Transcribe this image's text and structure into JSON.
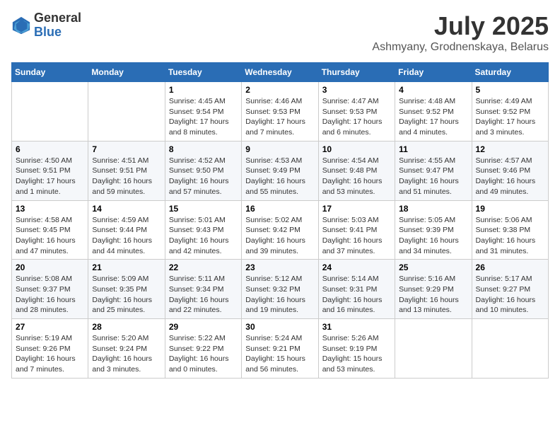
{
  "header": {
    "logo_general": "General",
    "logo_blue": "Blue",
    "month_title": "July 2025",
    "location": "Ashmyany, Grodnenskaya, Belarus"
  },
  "weekdays": [
    "Sunday",
    "Monday",
    "Tuesday",
    "Wednesday",
    "Thursday",
    "Friday",
    "Saturday"
  ],
  "weeks": [
    [
      {
        "day": "",
        "info": ""
      },
      {
        "day": "",
        "info": ""
      },
      {
        "day": "1",
        "info": "Sunrise: 4:45 AM\nSunset: 9:54 PM\nDaylight: 17 hours and 8 minutes."
      },
      {
        "day": "2",
        "info": "Sunrise: 4:46 AM\nSunset: 9:53 PM\nDaylight: 17 hours and 7 minutes."
      },
      {
        "day": "3",
        "info": "Sunrise: 4:47 AM\nSunset: 9:53 PM\nDaylight: 17 hours and 6 minutes."
      },
      {
        "day": "4",
        "info": "Sunrise: 4:48 AM\nSunset: 9:52 PM\nDaylight: 17 hours and 4 minutes."
      },
      {
        "day": "5",
        "info": "Sunrise: 4:49 AM\nSunset: 9:52 PM\nDaylight: 17 hours and 3 minutes."
      }
    ],
    [
      {
        "day": "6",
        "info": "Sunrise: 4:50 AM\nSunset: 9:51 PM\nDaylight: 17 hours and 1 minute."
      },
      {
        "day": "7",
        "info": "Sunrise: 4:51 AM\nSunset: 9:51 PM\nDaylight: 16 hours and 59 minutes."
      },
      {
        "day": "8",
        "info": "Sunrise: 4:52 AM\nSunset: 9:50 PM\nDaylight: 16 hours and 57 minutes."
      },
      {
        "day": "9",
        "info": "Sunrise: 4:53 AM\nSunset: 9:49 PM\nDaylight: 16 hours and 55 minutes."
      },
      {
        "day": "10",
        "info": "Sunrise: 4:54 AM\nSunset: 9:48 PM\nDaylight: 16 hours and 53 minutes."
      },
      {
        "day": "11",
        "info": "Sunrise: 4:55 AM\nSunset: 9:47 PM\nDaylight: 16 hours and 51 minutes."
      },
      {
        "day": "12",
        "info": "Sunrise: 4:57 AM\nSunset: 9:46 PM\nDaylight: 16 hours and 49 minutes."
      }
    ],
    [
      {
        "day": "13",
        "info": "Sunrise: 4:58 AM\nSunset: 9:45 PM\nDaylight: 16 hours and 47 minutes."
      },
      {
        "day": "14",
        "info": "Sunrise: 4:59 AM\nSunset: 9:44 PM\nDaylight: 16 hours and 44 minutes."
      },
      {
        "day": "15",
        "info": "Sunrise: 5:01 AM\nSunset: 9:43 PM\nDaylight: 16 hours and 42 minutes."
      },
      {
        "day": "16",
        "info": "Sunrise: 5:02 AM\nSunset: 9:42 PM\nDaylight: 16 hours and 39 minutes."
      },
      {
        "day": "17",
        "info": "Sunrise: 5:03 AM\nSunset: 9:41 PM\nDaylight: 16 hours and 37 minutes."
      },
      {
        "day": "18",
        "info": "Sunrise: 5:05 AM\nSunset: 9:39 PM\nDaylight: 16 hours and 34 minutes."
      },
      {
        "day": "19",
        "info": "Sunrise: 5:06 AM\nSunset: 9:38 PM\nDaylight: 16 hours and 31 minutes."
      }
    ],
    [
      {
        "day": "20",
        "info": "Sunrise: 5:08 AM\nSunset: 9:37 PM\nDaylight: 16 hours and 28 minutes."
      },
      {
        "day": "21",
        "info": "Sunrise: 5:09 AM\nSunset: 9:35 PM\nDaylight: 16 hours and 25 minutes."
      },
      {
        "day": "22",
        "info": "Sunrise: 5:11 AM\nSunset: 9:34 PM\nDaylight: 16 hours and 22 minutes."
      },
      {
        "day": "23",
        "info": "Sunrise: 5:12 AM\nSunset: 9:32 PM\nDaylight: 16 hours and 19 minutes."
      },
      {
        "day": "24",
        "info": "Sunrise: 5:14 AM\nSunset: 9:31 PM\nDaylight: 16 hours and 16 minutes."
      },
      {
        "day": "25",
        "info": "Sunrise: 5:16 AM\nSunset: 9:29 PM\nDaylight: 16 hours and 13 minutes."
      },
      {
        "day": "26",
        "info": "Sunrise: 5:17 AM\nSunset: 9:27 PM\nDaylight: 16 hours and 10 minutes."
      }
    ],
    [
      {
        "day": "27",
        "info": "Sunrise: 5:19 AM\nSunset: 9:26 PM\nDaylight: 16 hours and 7 minutes."
      },
      {
        "day": "28",
        "info": "Sunrise: 5:20 AM\nSunset: 9:24 PM\nDaylight: 16 hours and 3 minutes."
      },
      {
        "day": "29",
        "info": "Sunrise: 5:22 AM\nSunset: 9:22 PM\nDaylight: 16 hours and 0 minutes."
      },
      {
        "day": "30",
        "info": "Sunrise: 5:24 AM\nSunset: 9:21 PM\nDaylight: 15 hours and 56 minutes."
      },
      {
        "day": "31",
        "info": "Sunrise: 5:26 AM\nSunset: 9:19 PM\nDaylight: 15 hours and 53 minutes."
      },
      {
        "day": "",
        "info": ""
      },
      {
        "day": "",
        "info": ""
      }
    ]
  ]
}
